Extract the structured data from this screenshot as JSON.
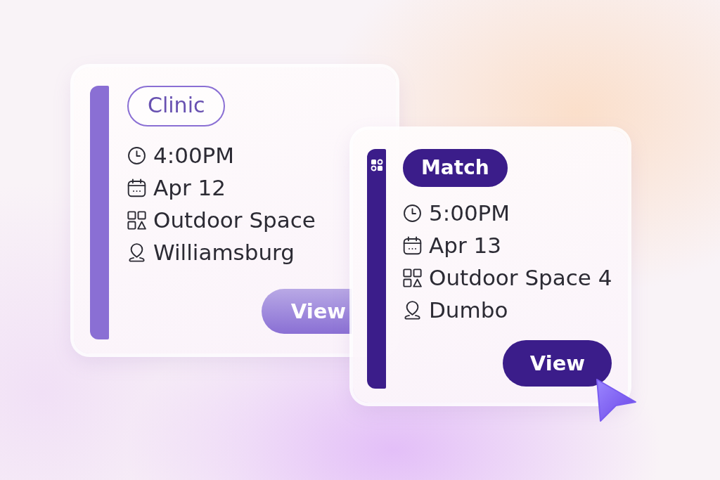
{
  "events": [
    {
      "tag": "Clinic",
      "time": "4:00PM",
      "date": "Apr 12",
      "space": "Outdoor Space",
      "area": "Williamsburg",
      "button": "View",
      "color": "#8a6fd4",
      "selected": false
    },
    {
      "tag": "Match",
      "time": "5:00PM",
      "date": "Apr 13",
      "space": "Outdoor Space 4",
      "area": "Dumbo",
      "button": "View",
      "color": "#3b1d8a",
      "selected": true
    }
  ]
}
